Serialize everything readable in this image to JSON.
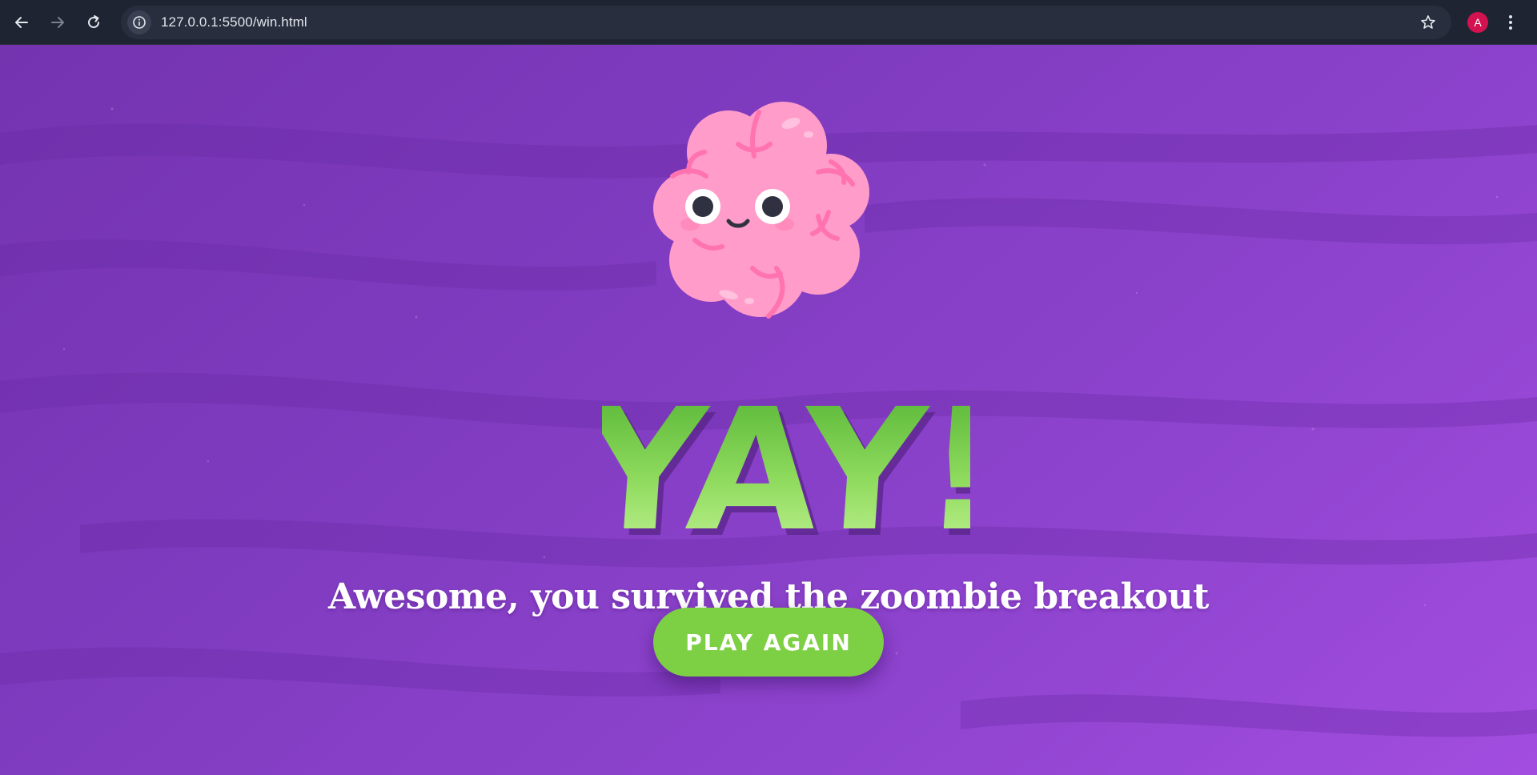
{
  "browser": {
    "url": "127.0.0.1:5500/win.html",
    "profile_initial": "A",
    "icons": {
      "back": "arrow-left-icon",
      "forward": "arrow-right-icon",
      "reload": "reload-icon",
      "site_info": "info-icon",
      "bookmark": "star-icon",
      "menu": "more-vert-icon"
    }
  },
  "page": {
    "heading": "YAY!",
    "message": "Awesome, you survived the zoombie breakout",
    "play_again_label": "PLAY AGAIN"
  },
  "colors": {
    "background": "#7f3bbf",
    "heading_green": "#6cc43c",
    "button_green": "#7dcf44",
    "brain_pink": "#ff9cc9",
    "avatar": "#d3134f"
  }
}
